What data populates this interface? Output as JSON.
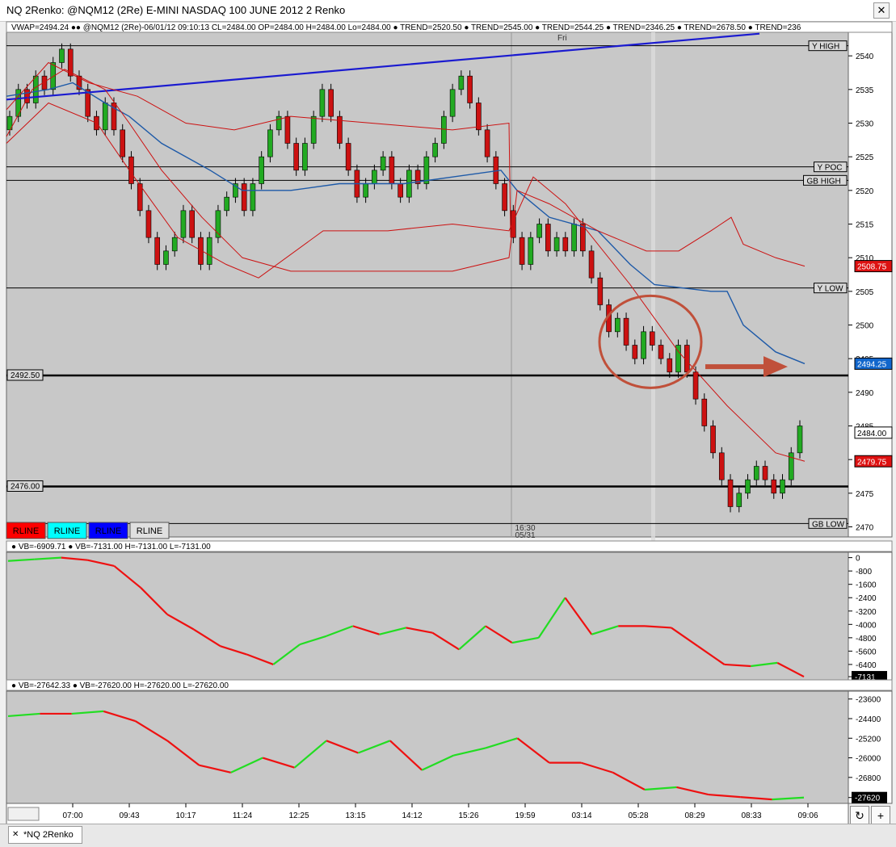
{
  "window": {
    "title": "NQ 2Renko: @NQM12 (2Re) E-MINI NASDAQ 100 JUNE 2012 2 Renko"
  },
  "tab": {
    "label": "*NQ 2Renko"
  },
  "header_text": "VWAP=2494.24 ●● @NQM12 (2Re)-06/01/12 09:10:13 CL=2484.00 OP=2484.00 H=2484.00 Lo=2484.00 ● TREND=2520.50 ● TREND=2545.00 ● TREND=2544.25 ● TREND=2346.25 ● TREND=2678.50 ● TREND=236",
  "fri_label": "Fri",
  "session_label": [
    "16:30",
    "05/31"
  ],
  "rline_buttons": [
    {
      "label": "RLINE",
      "color": "#ff0000"
    },
    {
      "label": "RLINE",
      "color": "#00ffff"
    },
    {
      "label": "RLINE",
      "color": "#0000ff"
    },
    {
      "label": "RLINE",
      "color": "#e0e0e0"
    }
  ],
  "price_levels": [
    {
      "label": "Y HIGH",
      "price": 2541.5,
      "kind": "thin"
    },
    {
      "label": "Y POC",
      "price": 2523.5,
      "kind": "thin"
    },
    {
      "label": "GB HIGH",
      "price": 2521.5,
      "kind": "thin"
    },
    {
      "label": "Y LOW",
      "price": 2505.5,
      "kind": "thin"
    },
    {
      "label": "GB LOW",
      "price": 2470.5,
      "kind": "thin"
    },
    {
      "label": "2492.50",
      "price": 2492.5,
      "kind": "thick"
    },
    {
      "label": "2476.00",
      "price": 2476.0,
      "kind": "thick"
    }
  ],
  "price_tags": [
    {
      "label": "2508.75",
      "price": 2508.75,
      "color": "#dd1111"
    },
    {
      "label": "2494.25",
      "price": 2494.25,
      "color": "#1166cc"
    },
    {
      "label": "2484.00",
      "price": 2484.0,
      "color": "#000000"
    },
    {
      "label": "2479.75",
      "price": 2479.75,
      "color": "#dd1111"
    }
  ],
  "panel2_header": "● VB=-6909.71 ● VB=-7131.00 H=-7131.00 L=-7131.00",
  "panel3_header": "● VB=-27642.33 ● VB=-27620.00 H=-27620.00 L=-27620.00",
  "panel2_tag": "-7131",
  "panel3_tag": "-27620",
  "chart_data": {
    "type": "candlestick",
    "title": "NQ 2Renko: @NQM12 (2Re) E-MINI NASDAQ 100 JUNE 2012 2 Renko",
    "x_labels": [
      "07:00",
      "09:43",
      "10:17",
      "11:24",
      "12:25",
      "13:15",
      "14:12",
      "15:26",
      "19:59",
      "03:14",
      "05:28",
      "08:29",
      "08:33",
      "09:06"
    ],
    "price_axis": {
      "ticks": [
        2540,
        2535,
        2530,
        2525,
        2520,
        2515,
        2510,
        2505,
        2500,
        2495,
        2490,
        2485,
        2480,
        2475,
        2470
      ],
      "range": [
        2468.5,
        2543.5
      ]
    },
    "renko_close": [
      2531,
      2535,
      2533,
      2537,
      2535,
      2539,
      2541,
      2537,
      2535,
      2531,
      2529,
      2533,
      2529,
      2525,
      2521,
      2517,
      2513,
      2509,
      2511,
      2513,
      2517,
      2513,
      2509,
      2513,
      2517,
      2519,
      2521,
      2517,
      2521,
      2525,
      2529,
      2531,
      2527,
      2523,
      2527,
      2531,
      2535,
      2531,
      2527,
      2523,
      2519,
      2521,
      2523,
      2525,
      2521,
      2519,
      2523,
      2521,
      2525,
      2527,
      2531,
      2535,
      2537,
      2533,
      2529,
      2525,
      2521,
      2517,
      2513,
      2509,
      2513,
      2515,
      2511,
      2513,
      2511,
      2515,
      2511,
      2507,
      2503,
      2499,
      2501,
      2497,
      2495,
      2499,
      2497,
      2495,
      2493,
      2497,
      2493,
      2489,
      2485,
      2481,
      2477,
      2473,
      2475,
      2477,
      2479,
      2477,
      2475,
      2477,
      2481,
      2485
    ],
    "overlays": [
      {
        "name": "VWAP",
        "value_last": 2494.24,
        "color": "#1e5aa8"
      },
      {
        "name": "TREND",
        "value_last": 2545.0,
        "color": "#0000cc"
      }
    ],
    "panel2": {
      "type": "line",
      "ticks": [
        0,
        -800,
        -1600,
        -2400,
        -3200,
        -4000,
        -4800,
        -5600,
        -6400,
        -7131
      ],
      "values": [
        -200,
        -100,
        0,
        -150,
        -500,
        -1800,
        -3400,
        -4300,
        -5300,
        -5800,
        -6400,
        -5200,
        -4700,
        -4100,
        -4600,
        -4200,
        -4500,
        -5500,
        -4100,
        -5100,
        -4800,
        -2400,
        -4600,
        -4100,
        -4100,
        -4200,
        -5300,
        -6400,
        -6500,
        -6300,
        -7131
      ]
    },
    "panel3": {
      "type": "line",
      "ticks": [
        -23600,
        -24400,
        -25200,
        -26000,
        -26800,
        -27620
      ],
      "values": [
        -24300,
        -24200,
        -24200,
        -24100,
        -24500,
        -25300,
        -26300,
        -26600,
        -26000,
        -26400,
        -25300,
        -25800,
        -25300,
        -26500,
        -25900,
        -25600,
        -25200,
        -26200,
        -26200,
        -26600,
        -27300,
        -27200,
        -27500,
        -27600,
        -27700,
        -27620
      ]
    }
  }
}
